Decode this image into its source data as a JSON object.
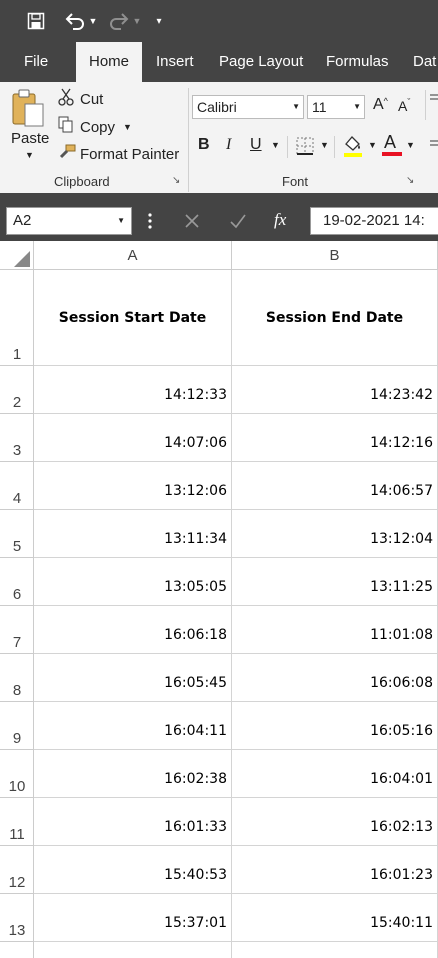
{
  "ribbon_tabs": [
    "File",
    "Home",
    "Insert",
    "Page Layout",
    "Formulas",
    "Dat"
  ],
  "clipboard": {
    "paste_label": "Paste",
    "cut_label": "Cut",
    "copy_label": "Copy",
    "format_painter_label": "Format Painter",
    "group_label": "Clipboard"
  },
  "font": {
    "name": "Calibri",
    "size": "11",
    "group_label": "Font",
    "bold": "B",
    "italic": "I",
    "underline": "U",
    "grow": "A",
    "shrink": "A",
    "color_letter": "A"
  },
  "formula_bar": {
    "name_box": "A2",
    "fx": "fx",
    "value": "19-02-2021  14:"
  },
  "columns": [
    "A",
    "B"
  ],
  "header_row": {
    "row": "1",
    "a": "Session Start Date",
    "b": "Session End Date"
  },
  "rows": [
    {
      "row": "2",
      "a": "14:12:33",
      "b": "14:23:42"
    },
    {
      "row": "3",
      "a": "14:07:06",
      "b": "14:12:16"
    },
    {
      "row": "4",
      "a": "13:12:06",
      "b": "14:06:57"
    },
    {
      "row": "5",
      "a": "13:11:34",
      "b": "13:12:04"
    },
    {
      "row": "6",
      "a": "13:05:05",
      "b": "13:11:25"
    },
    {
      "row": "7",
      "a": "16:06:18",
      "b": "11:01:08"
    },
    {
      "row": "8",
      "a": "16:05:45",
      "b": "16:06:08"
    },
    {
      "row": "9",
      "a": "16:04:11",
      "b": "16:05:16"
    },
    {
      "row": "10",
      "a": "16:02:38",
      "b": "16:04:01"
    },
    {
      "row": "11",
      "a": "16:01:33",
      "b": "16:02:13"
    },
    {
      "row": "12",
      "a": "15:40:53",
      "b": "16:01:23"
    },
    {
      "row": "13",
      "a": "15:37:01",
      "b": "15:40:11"
    }
  ],
  "colors": {
    "accent": "#217346",
    "dark_chrome": "#444444",
    "highlight_yellow": "#ffff00",
    "font_red": "#e81123"
  }
}
